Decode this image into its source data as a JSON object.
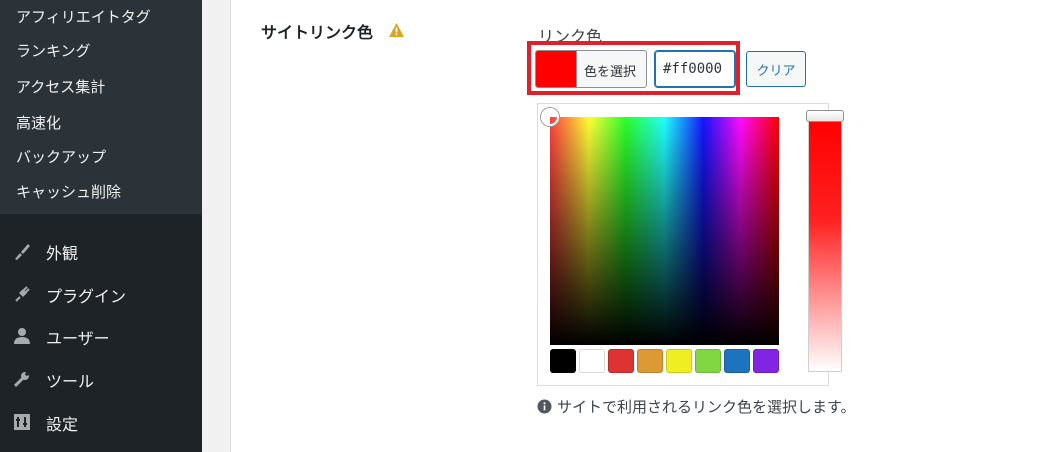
{
  "sidebar": {
    "submenu": [
      "アフィリエイトタグ",
      "ランキング",
      "アクセス集計",
      "高速化",
      "バックアップ",
      "キャッシュ削除"
    ],
    "menu": [
      {
        "label": "外観",
        "icon": "paintbrush-icon"
      },
      {
        "label": "プラグイン",
        "icon": "plugin-icon"
      },
      {
        "label": "ユーザー",
        "icon": "user-icon"
      },
      {
        "label": "ツール",
        "icon": "wrench-icon"
      },
      {
        "label": "設定",
        "icon": "settings-icon"
      }
    ]
  },
  "setting": {
    "label": "サイトリンク色",
    "field_label": "リンク色",
    "color_button": "色を選択",
    "hex_value": "#ff0000",
    "clear_button": "クリア",
    "help_text": "サイトで利用されるリンク色を選択します。"
  },
  "picker": {
    "palette": [
      "#000000",
      "#ffffff",
      "#dd3333",
      "#dd9933",
      "#eeee22",
      "#81d742",
      "#1e73be",
      "#8224e3"
    ]
  },
  "colors": {
    "selected": "#ff0000",
    "highlight": "#e0202a",
    "accent": "#2271b1",
    "warning": "#dba617"
  }
}
